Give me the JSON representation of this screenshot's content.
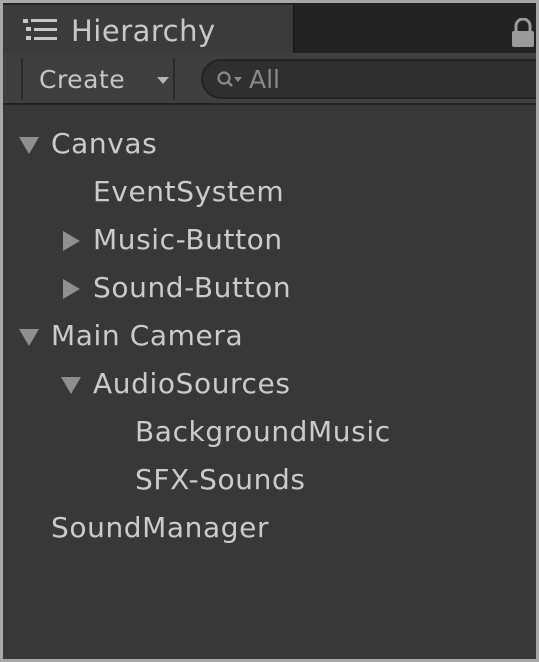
{
  "window": {
    "tab_title": "Hierarchy",
    "tab_icon": "hierarchy-list-icon",
    "lock_icon": "lock-icon"
  },
  "toolbar": {
    "create_label": "Create",
    "dropdown_icon": "dropdown-arrow-icon",
    "search_icon": "search-icon",
    "search_placeholder": "All"
  },
  "tree": {
    "items": [
      {
        "label": "Canvas",
        "depth": 0,
        "expander": "expanded"
      },
      {
        "label": "EventSystem",
        "depth": 1,
        "expander": "none"
      },
      {
        "label": "Music-Button",
        "depth": 1,
        "expander": "collapsed"
      },
      {
        "label": "Sound-Button",
        "depth": 1,
        "expander": "collapsed"
      },
      {
        "label": "Main Camera",
        "depth": 0,
        "expander": "expanded"
      },
      {
        "label": "AudioSources",
        "depth": 1,
        "expander": "expanded"
      },
      {
        "label": "BackgroundMusic",
        "depth": 2,
        "expander": "none"
      },
      {
        "label": "SFX-Sounds",
        "depth": 2,
        "expander": "none"
      },
      {
        "label": "SoundManager",
        "depth": 0,
        "expander": "none"
      }
    ]
  },
  "colors": {
    "panel_bg": "#383838",
    "text": "#cbcbcb",
    "arrow": "#8f8f8f",
    "tab_strip": "#232323"
  }
}
